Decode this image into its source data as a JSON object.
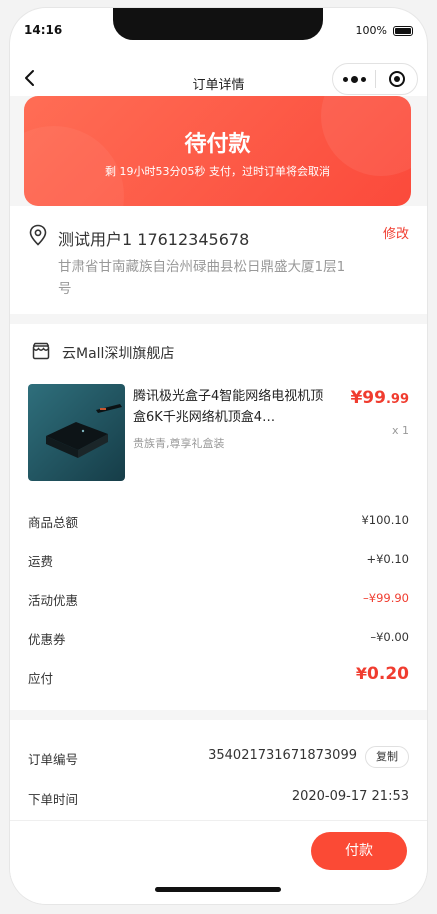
{
  "status_bar": {
    "time": "14:16",
    "battery": "100%"
  },
  "navbar": {
    "title": "订单详情"
  },
  "order_status": {
    "title": "待付款",
    "countdown": "剩 19小时53分05秒 支付，过时订单将会取消"
  },
  "address": {
    "name_phone": "测试用户1 17612345678",
    "edit_label": "修改",
    "detail": "甘肃省甘南藏族自治州碌曲县松日鼎盛大厦1层1号"
  },
  "shop": {
    "name": "云Mall深圳旗舰店"
  },
  "product": {
    "title": "腾讯极光盒子4智能网络电视机顶盒6K千兆网络机顶盒4…",
    "spec": "贵族青,尊享礼盒装",
    "price_main": "¥99",
    "price_decimal": ".99",
    "quantity": "x 1"
  },
  "summary": {
    "goods_total_label": "商品总额",
    "goods_total_value": "¥100.10",
    "shipping_label": "运费",
    "shipping_value": "+¥0.10",
    "promo_label": "活动优惠",
    "promo_value": "–¥99.90",
    "coupon_label": "优惠券",
    "coupon_value": "–¥0.00",
    "payable_label": "应付",
    "payable_yen": "¥",
    "payable_value": "0.20"
  },
  "order_info": {
    "number_label": "订单编号",
    "number_value": "354021731671873099",
    "copy_label": "复制",
    "time_label": "下单时间",
    "time_value": "2020-09-17 21:53"
  },
  "actions": {
    "pay_label": "付款"
  },
  "colors": {
    "accent": "#fb4a35",
    "price_red": "#f03c2f"
  }
}
